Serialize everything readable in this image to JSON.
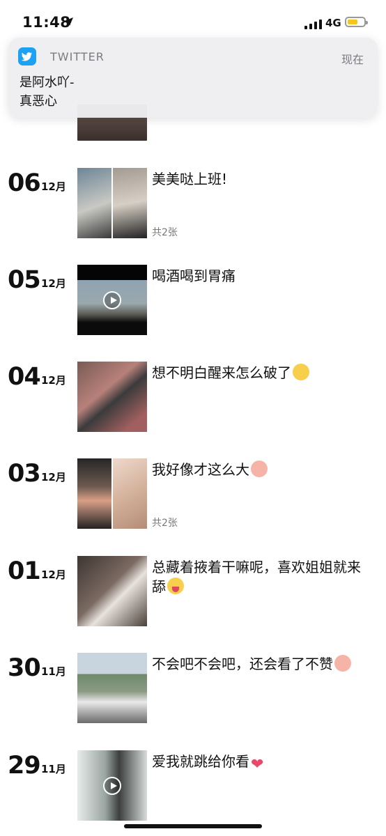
{
  "status_bar": {
    "time": "11:48",
    "network": "4G",
    "battery_color": "#f3c51d"
  },
  "notification": {
    "app_name": "TWITTER",
    "time": "现在",
    "title": "是阿水吖-",
    "body": "真恶心",
    "icon": "twitter-bird-icon",
    "accent": "#1da1f2"
  },
  "posts": [
    {
      "day": "06",
      "month": "12月",
      "caption": "美美哒上班!",
      "count": "共2张"
    },
    {
      "day": "05",
      "month": "12月",
      "caption": "喝酒喝到胃痛",
      "video": true
    },
    {
      "day": "04",
      "month": "12月",
      "caption": "想不明白醒来怎么破了",
      "emoji": "sleeping-face-emoji"
    },
    {
      "day": "03",
      "month": "12月",
      "caption": "我好像才这么大",
      "emoji": "pig-face-emoji",
      "count": "共2张"
    },
    {
      "day": "01",
      "month": "12月",
      "caption": "总藏着掖着干嘛呢，喜欢姐姐就来舔",
      "emoji": "tongue-face-emoji"
    },
    {
      "day": "30",
      "month": "11月",
      "caption": "不会吧不会吧，还会看了不赞",
      "emoji": "pig-face-emoji"
    },
    {
      "day": "29",
      "month": "11月",
      "caption": "爱我就跳给你看",
      "emoji": "heart-emoji",
      "video": true
    }
  ]
}
